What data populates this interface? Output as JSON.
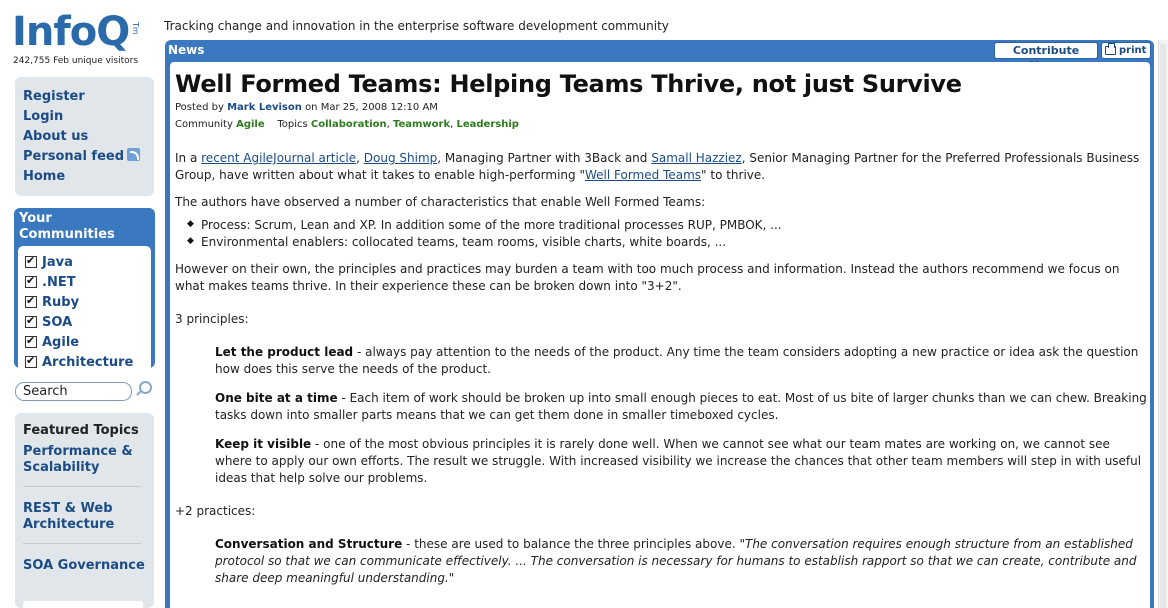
{
  "logo": {
    "name": "InfoQ",
    "tm": "Tm",
    "visitors": "242,755 Feb unique visitors"
  },
  "tagline": "Tracking change and innovation in the enterprise software development community",
  "nav": {
    "items": [
      "Register",
      "Login",
      "About us",
      "Personal feed",
      "Home"
    ]
  },
  "communities": {
    "title": "Your Communities",
    "items": [
      "Java",
      ".NET",
      "Ruby",
      "SOA",
      "Agile",
      "Architecture"
    ]
  },
  "search": {
    "value": "Search"
  },
  "featured": {
    "title": "Featured Topics",
    "items": [
      "Performance & Scalability",
      "REST & Web Architecture",
      "SOA Governance"
    ]
  },
  "panel": {
    "tab": "News",
    "contribute": "Contribute News",
    "print": "print"
  },
  "article": {
    "title": "Well Formed Teams: Helping Teams Thrive, not just Survive",
    "posted_by": "Posted by",
    "author": "Mark Levison",
    "date": "on Mar 25, 2008 12:10 AM",
    "community_label": "Community",
    "community": "Agile",
    "topics_label": "Topics",
    "topics": [
      "Collaboration",
      "Teamwork",
      "Leadership"
    ],
    "intro": {
      "t1": "In a ",
      "link1": "recent AgileJournal article",
      "t2": ", ",
      "link2": "Doug Shimp",
      "t3": ", Managing Partner with 3Back and ",
      "link3": "Samall Hazziez",
      "t4": ", Senior Managing Partner for the Preferred Professionals Business Group, have written about what it takes to enable high-performing \"",
      "link4": "Well Formed Teams",
      "t5": "\" to thrive."
    },
    "observed": "The authors have observed a number of characteristics that enable Well Formed Teams:",
    "characteristics": [
      "Process: Scrum, Lean and XP. In addition some of the more traditional processes RUP, PMBOK, ...",
      "Environmental enablers: collocated teams, team rooms, visible charts, white boards, ..."
    ],
    "however": "However on their own, the principles and practices may burden a team with too much process and information. Instead the authors recommend we focus on what makes teams thrive. In their experience these can be broken down into \"3+2\".",
    "principles_label": "3 principles:",
    "principles": [
      {
        "name": "Let the product lead",
        "text": " - always pay attention to the needs of the product. Any time the team considers adopting a new practice or idea ask the question how does this serve the needs of the product."
      },
      {
        "name": "One bite at a time",
        "text": " - Each item of work should be broken up into small enough pieces to eat. Most of us bite of larger chunks than we can chew. Breaking tasks down into smaller parts means that we can get them done in smaller timeboxed cycles."
      },
      {
        "name": "Keep it visible",
        "text": " - one of the most obvious principles it is rarely done well. When we cannot see what our team mates are working on, we cannot see where to apply our own efforts. The result we struggle. With increased visibility we increase the chances that other team members will step in with useful ideas that help solve our problems."
      }
    ],
    "practices_label": "+2 practices:",
    "practice1": {
      "name": "Conversation and Structure",
      "text": " - these are used to balance the three principles above. \"",
      "quote": "The conversation requires enough structure from an established protocol so that we can communicate effectively. ... The conversation is necessary for humans to establish rapport so that we can create, contribute and share deep meaningful understanding.",
      "end": "\""
    }
  }
}
